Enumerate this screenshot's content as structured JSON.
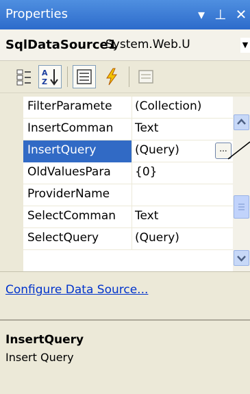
{
  "title_bar": {
    "title": "Properties",
    "dropdown_glyph": "▾",
    "pin_glyph": "⊥",
    "close_glyph": "✕"
  },
  "object_selector": {
    "name": "SqlDataSource1",
    "type": "System.Web.U",
    "arrow": "▼"
  },
  "toolbar": {
    "buttons": [
      "categorized-icon",
      "alphabetical-icon",
      "properties-icon",
      "events-icon",
      "property-pages-icon"
    ],
    "pressed": [
      "alphabetical-icon",
      "properties-icon"
    ]
  },
  "grid": {
    "rows": [
      {
        "name": "FilterParamete",
        "value": "(Collection)",
        "selected": false
      },
      {
        "name": "InsertComman",
        "value": "Text",
        "selected": false
      },
      {
        "name": "InsertQuery",
        "value": "(Query)",
        "selected": true,
        "button": "..."
      },
      {
        "name": "OldValuesPara",
        "value": "{0}",
        "selected": false
      },
      {
        "name": "ProviderName",
        "value": "",
        "selected": false
      },
      {
        "name": "SelectComman",
        "value": "Text",
        "selected": false
      },
      {
        "name": "SelectQuery",
        "value": "(Query)",
        "selected": false
      }
    ]
  },
  "commands": {
    "link": "Configure Data Source..."
  },
  "description": {
    "title": "InsertQuery",
    "text": "Insert Query"
  },
  "colors": {
    "title_bar": "#2d6bcb",
    "selection": "#316ac5",
    "link": "#0033cc"
  }
}
